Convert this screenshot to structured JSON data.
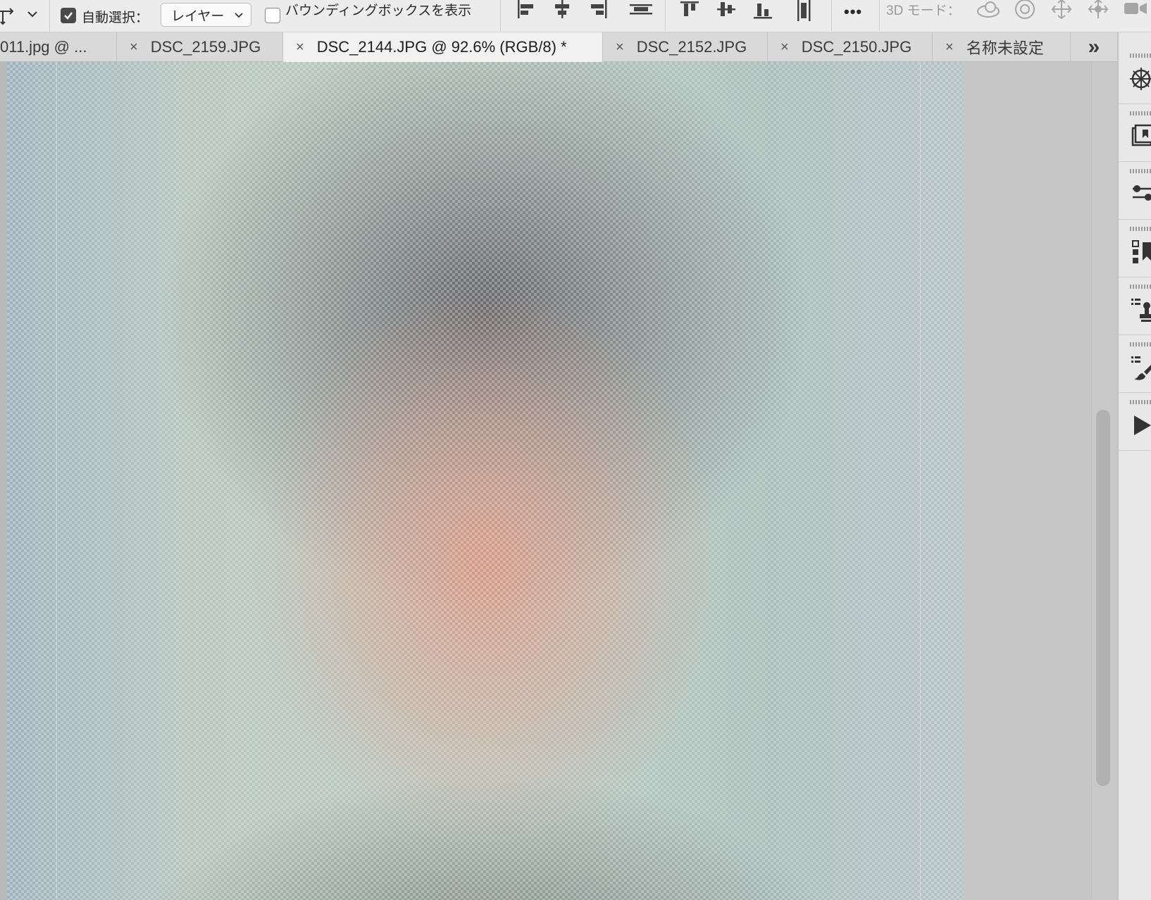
{
  "options_bar": {
    "auto_select_label": "自動選択：",
    "auto_select_checked": true,
    "layer_select_value": "レイヤー",
    "bounding_box_label": "バウンディングボックスを表示",
    "bounding_box_checked": false,
    "more_label": "•••",
    "mode_3d_label": "3D モード："
  },
  "tabs": [
    {
      "label": "011.jpg @ ...",
      "active": false
    },
    {
      "label": "DSC_2159.JPG",
      "active": false
    },
    {
      "label": "DSC_2144.JPG @ 92.6% (RGB/8) *",
      "active": true
    },
    {
      "label": "DSC_2152.JPG",
      "active": false
    },
    {
      "label": "DSC_2150.JPG",
      "active": false
    },
    {
      "label": "名称未設定",
      "active": false
    }
  ],
  "tab_close_glyph": "×",
  "tab_overflow_glyph": "»",
  "panels": [
    {
      "icon": "compass-icon"
    },
    {
      "icon": "navigator-icon"
    },
    {
      "icon": "adjustments-icon"
    },
    {
      "icon": "properties-icon"
    },
    {
      "icon": "stamp-presets-icon"
    },
    {
      "icon": "brush-presets-icon"
    },
    {
      "icon": "play-actions-icon"
    }
  ],
  "colors": {
    "toolbar_bg": "#ececec",
    "tab_active_bg": "#f1f1f1",
    "canvas_bg": "#c6c6c6"
  }
}
